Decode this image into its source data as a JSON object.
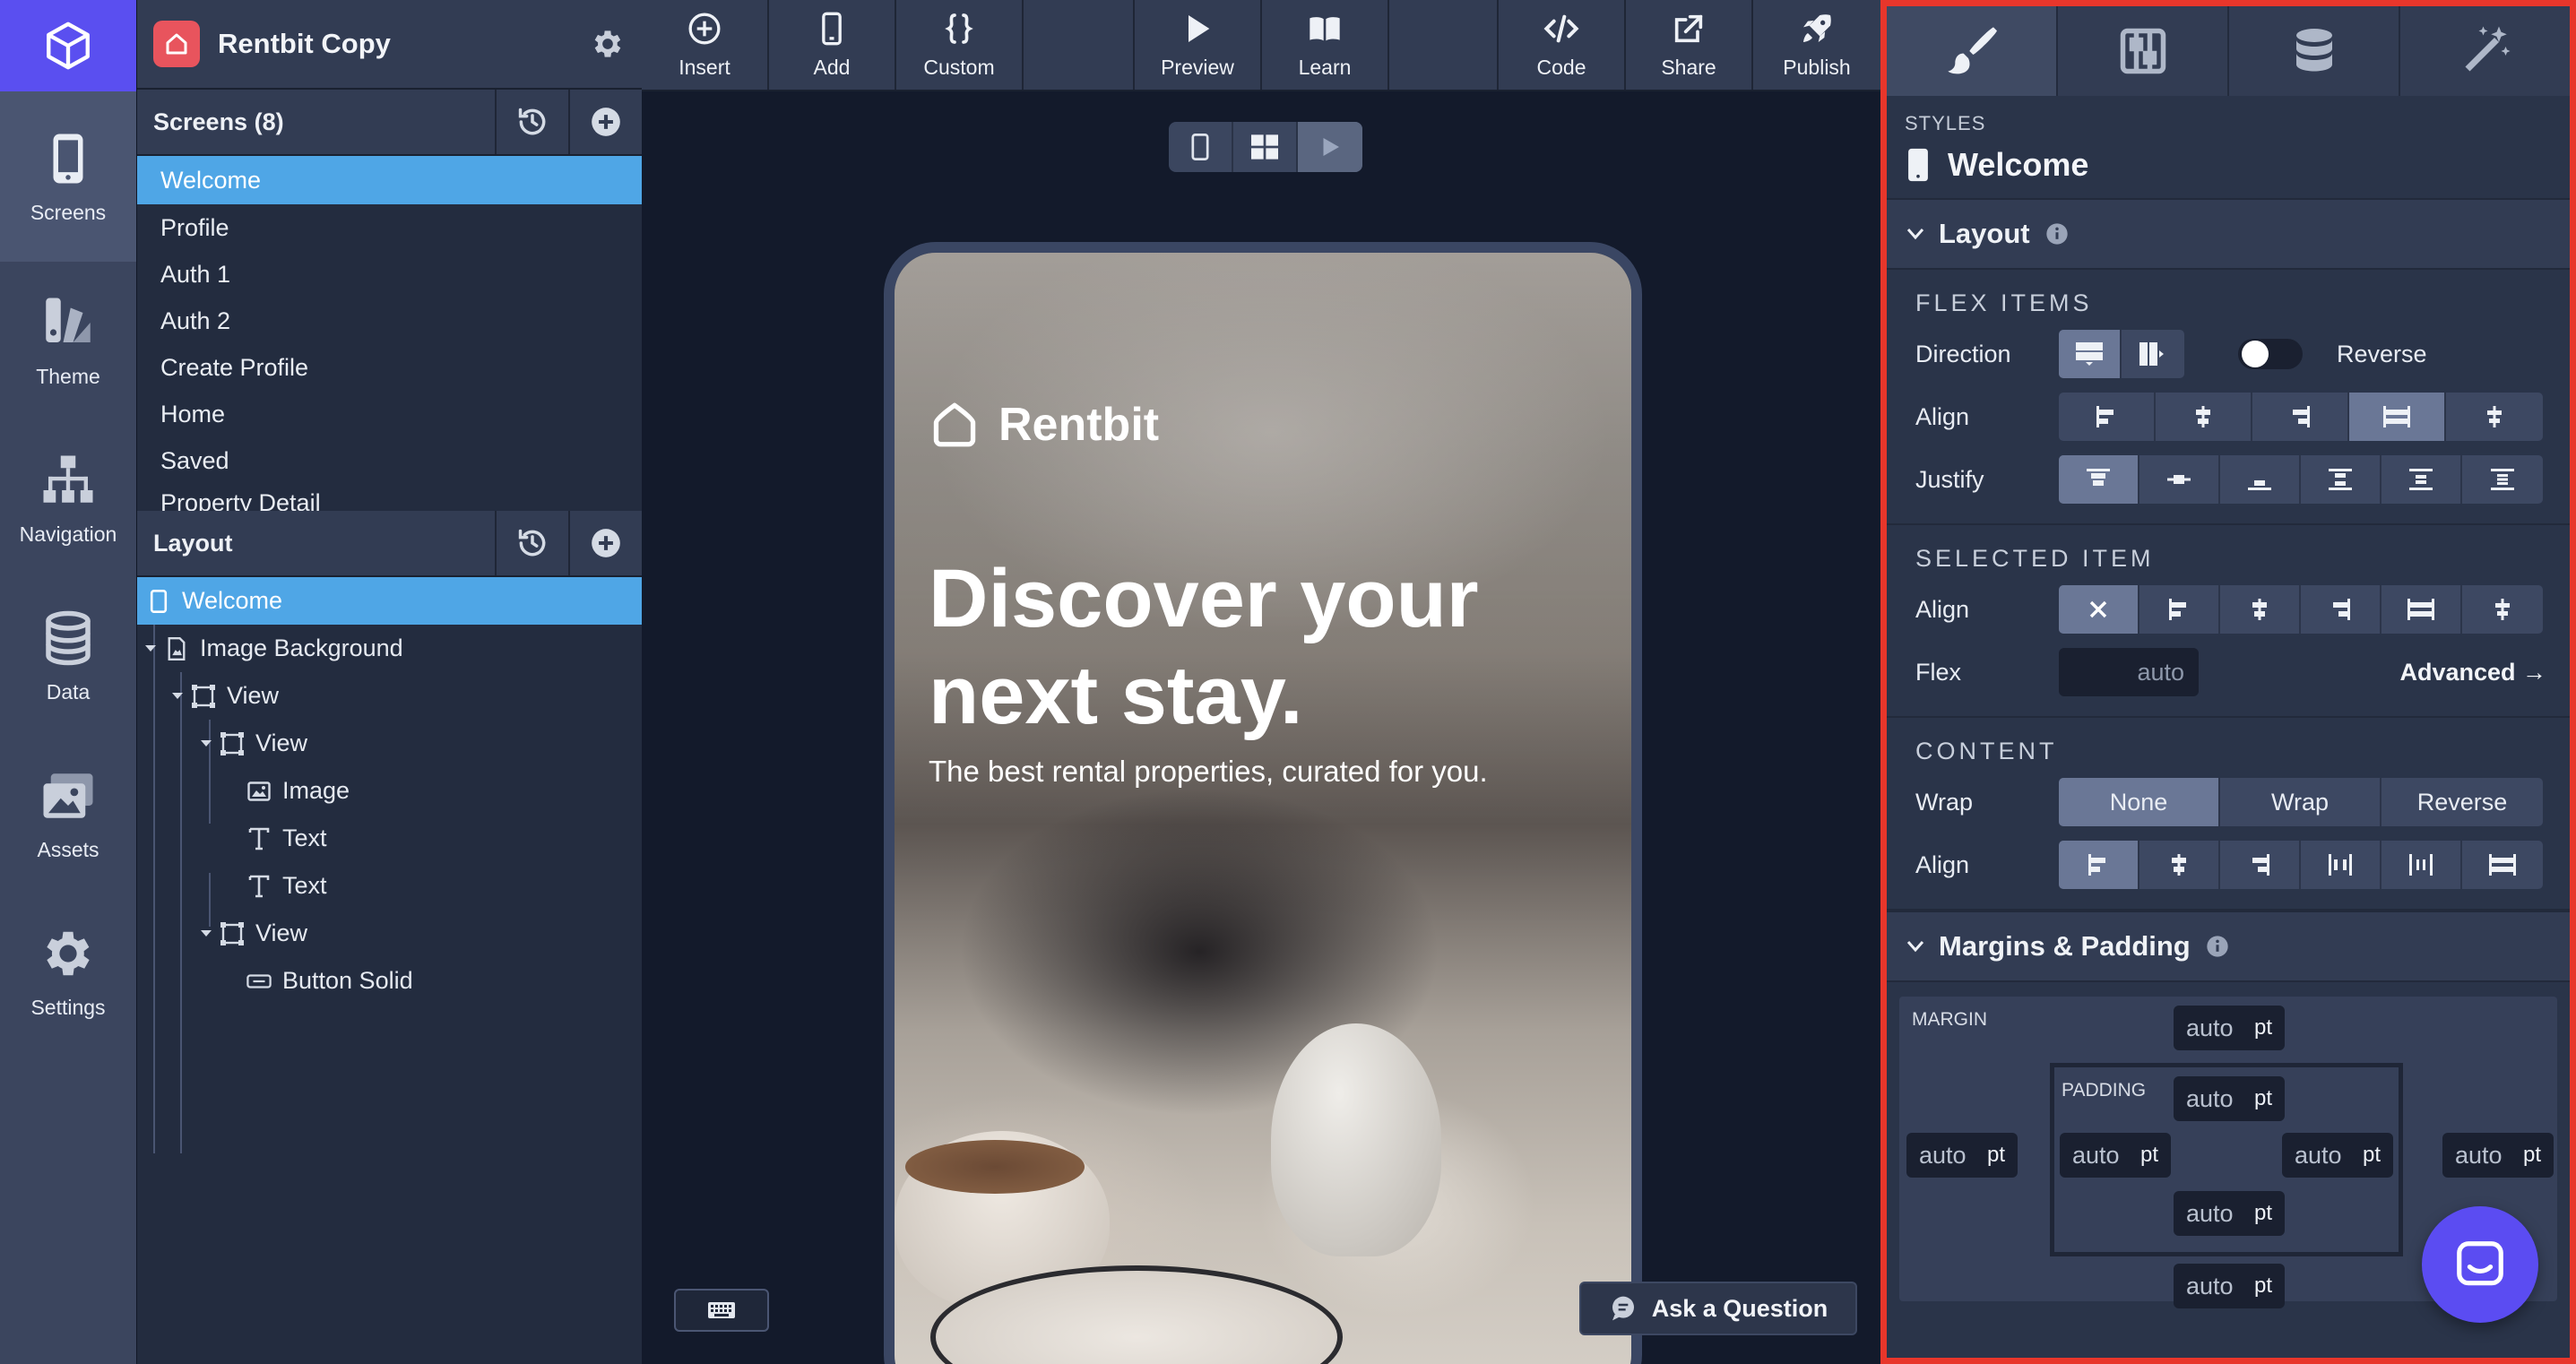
{
  "project": {
    "name": "Rentbit Copy"
  },
  "rail": [
    {
      "id": "screens",
      "label": "Screens",
      "active": true
    },
    {
      "id": "theme",
      "label": "Theme"
    },
    {
      "id": "navigation",
      "label": "Navigation"
    },
    {
      "id": "data",
      "label": "Data"
    },
    {
      "id": "assets",
      "label": "Assets"
    },
    {
      "id": "settings",
      "label": "Settings"
    }
  ],
  "screens_panel": {
    "title": "Screens (8)",
    "items": [
      "Welcome",
      "Profile",
      "Auth 1",
      "Auth 2",
      "Create Profile",
      "Home",
      "Saved",
      "Property Detail"
    ]
  },
  "layout_panel": {
    "title": "Layout",
    "nodes": [
      "Welcome",
      "Image Background",
      "View",
      "View",
      "Image",
      "Text",
      "Text",
      "View",
      "Button Solid"
    ]
  },
  "toolbar": {
    "insert": "Insert",
    "add": "Add",
    "custom": "Custom",
    "preview": "Preview",
    "learn": "Learn",
    "code": "Code",
    "share": "Share",
    "publish": "Publish"
  },
  "phone": {
    "brand": "Rentbit",
    "headline": "Discover your next stay.",
    "subtitle": "The best rental properties, curated for you."
  },
  "help": {
    "ask": "Ask a Question"
  },
  "styles": {
    "label": "STYLES",
    "screen_name": "Welcome",
    "layout_title": "Layout",
    "flex_items_title": "FLEX ITEMS",
    "direction_label": "Direction",
    "reverse_label": "Reverse",
    "align_label": "Align",
    "justify_label": "Justify",
    "selected_item_title": "SELECTED ITEM",
    "flex_label": "Flex",
    "flex_placeholder": "auto",
    "advanced": "Advanced →",
    "content_title": "CONTENT",
    "wrap_label": "Wrap",
    "wrap_options": [
      "None",
      "Wrap",
      "Reverse"
    ],
    "margins_title": "Margins & Padding",
    "margin_label": "MARGIN",
    "padding_label": "PADDING",
    "box_value": "auto",
    "box_unit": "pt"
  },
  "colors": {
    "accent": "#5a4ff0",
    "selection": "#4fa6e6",
    "highlight_border": "#e8362b"
  }
}
